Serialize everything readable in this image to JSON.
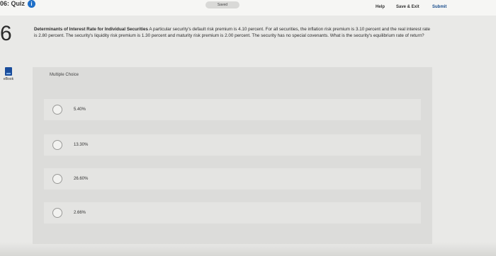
{
  "header": {
    "quiz_title": "06: Quiz",
    "saved_label": "Saved",
    "help_label": "Help",
    "save_exit_label": "Save & Exit",
    "submit_label": "Submit"
  },
  "question": {
    "number": "6",
    "title": "Determinants of Interest Rate for Individual Securities",
    "body": " A particular security's default risk premium is 4.10 percent. For all securities, the inflation risk premium is 3.10 percent and the real interest rate is 2.80 percent. The security's liquidity risk premium is 1.30 percent and maturity risk premium is 2.00 percent. The security has no special covenants. What is the security's equilibrium rate of return?"
  },
  "sidebar": {
    "ebook_label": "eBook"
  },
  "answers": {
    "type_label": "Multiple Choice",
    "choices": [
      {
        "label": "5.40%"
      },
      {
        "label": "13.30%"
      },
      {
        "label": "26.60%"
      },
      {
        "label": "2.66%"
      }
    ]
  },
  "colors": {
    "accent": "#1f6fc7",
    "ebook_icon": "#1a4d9c"
  }
}
